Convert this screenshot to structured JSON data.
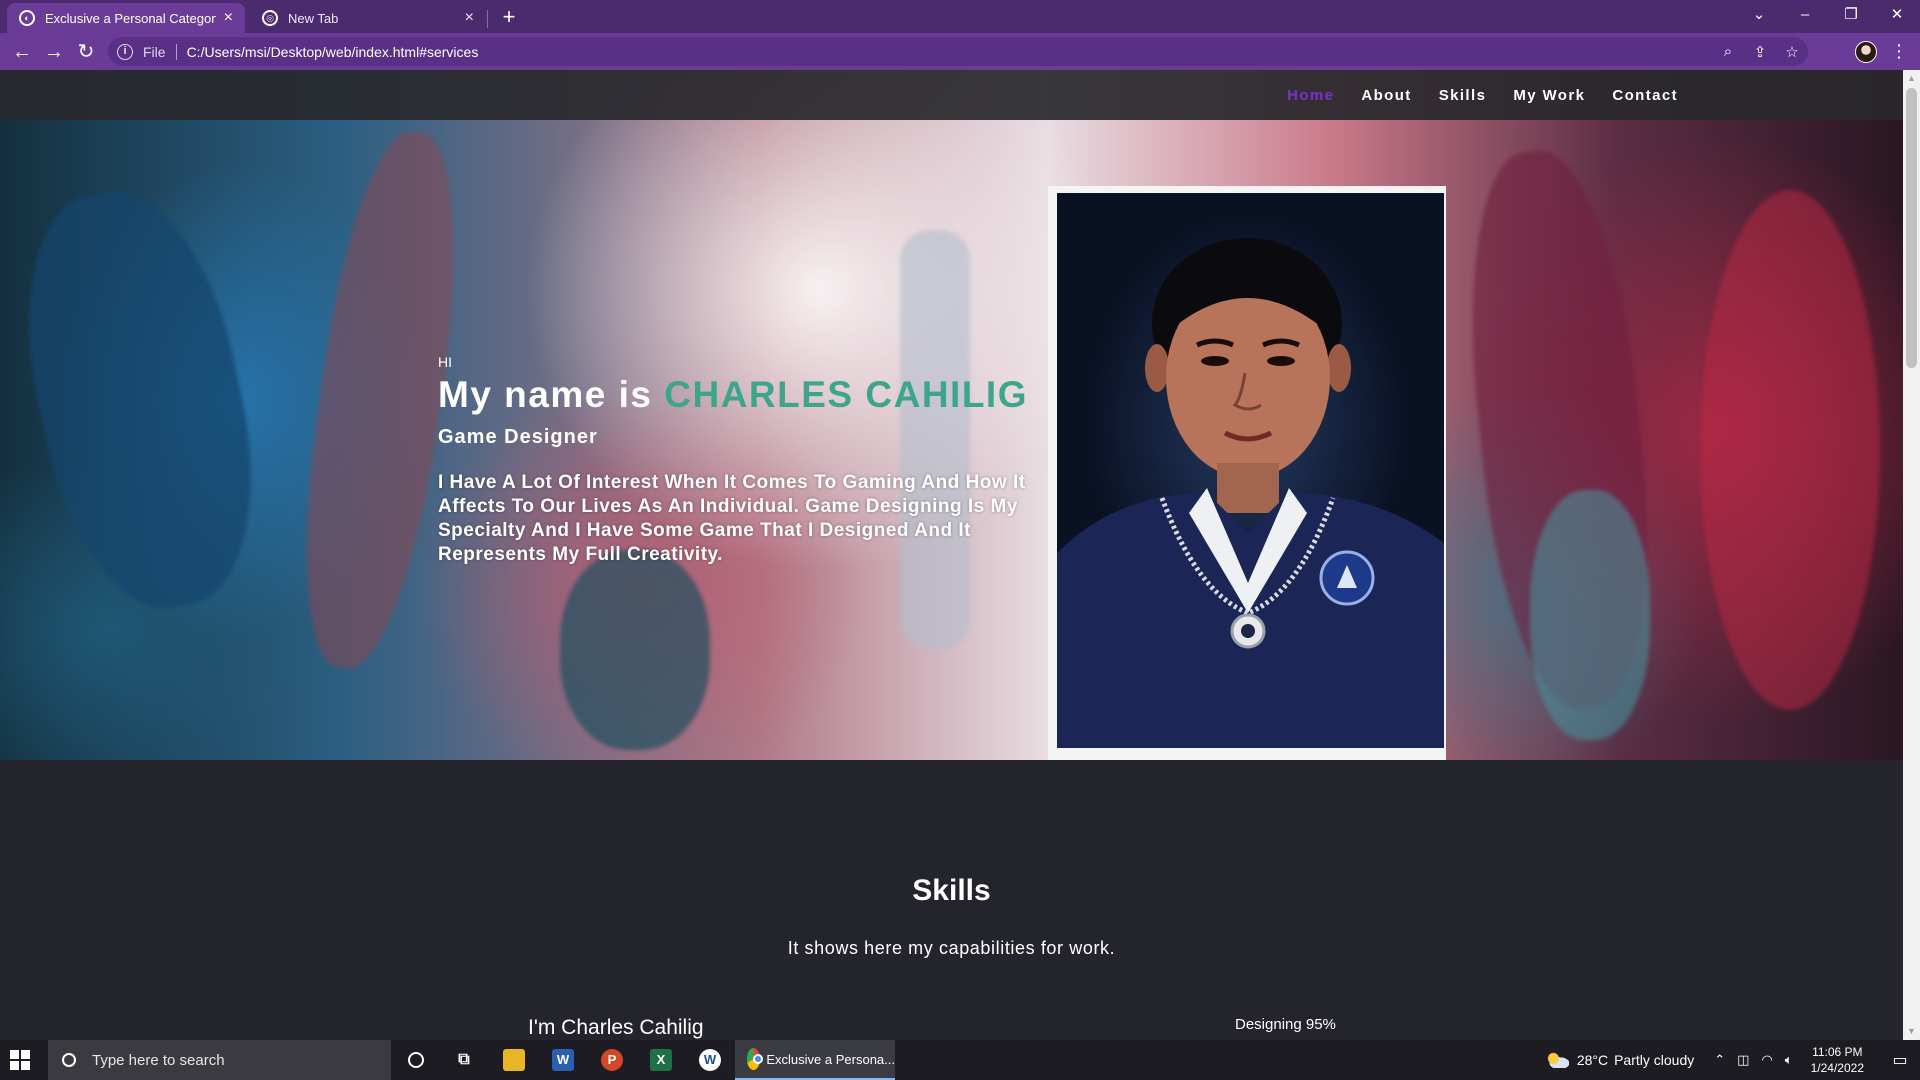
{
  "browser": {
    "tabs": [
      {
        "title": "Exclusive a Personal Category Bo",
        "active": true
      },
      {
        "title": "New Tab",
        "active": false
      }
    ],
    "url_scheme": "File",
    "url": "C:/Users/msi/Desktop/web/index.html#services",
    "icons": [
      "back-icon",
      "forward-icon",
      "reload-icon",
      "info-icon",
      "zoom-icon",
      "share-icon",
      "star-icon",
      "profile-avatar",
      "menu-icon"
    ]
  },
  "site": {
    "nav": [
      "Home",
      "About",
      "Skills",
      "My Work",
      "Contact"
    ],
    "active_nav": "Home",
    "accent_color": "#7b2fd0",
    "highlight_color": "#3ea58d"
  },
  "hero": {
    "greeting": "HI",
    "name_prefix": "My name is ",
    "name": "CHARLES CAHILIG",
    "role": "Game Designer",
    "bio": "I Have A Lot Of Interest When It Comes To Gaming And How It Affects To Our Lives As An Individual. Game Designing Is My Specialty And I Have Some Game That I Designed And It Represents My Full Creativity."
  },
  "skills": {
    "title": "Skills",
    "subtitle": "It shows here my capabilities for work.",
    "intro": "I'm Charles Cahilig",
    "items": [
      {
        "label": "Designing 95%",
        "level": 0.95
      }
    ]
  },
  "taskbar": {
    "search_placeholder": "Type here to search",
    "pinned": [
      "cortana-icon",
      "task-view-icon",
      "file-explorer-icon",
      "word-icon",
      "powerpoint-icon",
      "excel-icon",
      "app-icon"
    ],
    "active_window": "Exclusive a Persona...",
    "weather_temp": "28°C",
    "weather_condition": "Partly cloudy",
    "time": "11:06 PM",
    "date": "1/24/2022"
  }
}
